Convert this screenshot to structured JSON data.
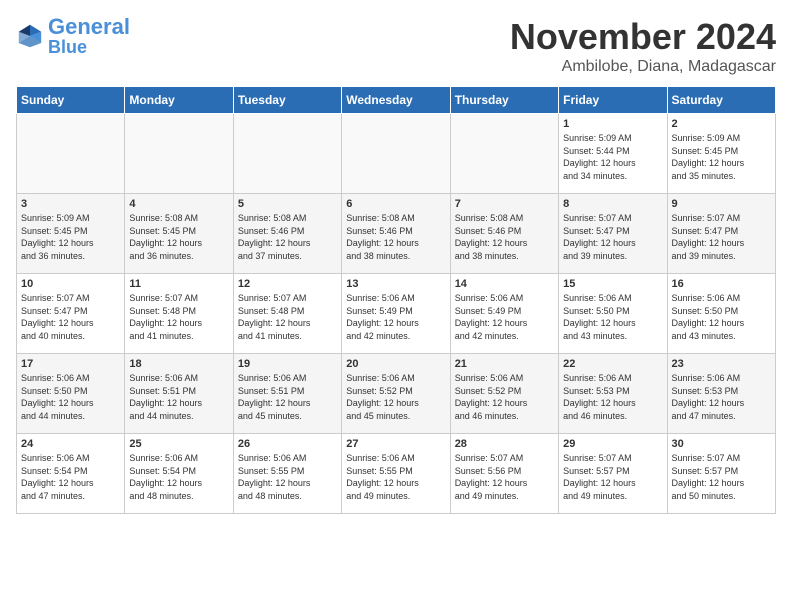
{
  "header": {
    "logo_line1": "General",
    "logo_line2": "Blue",
    "month_title": "November 2024",
    "subtitle": "Ambilobe, Diana, Madagascar"
  },
  "weekdays": [
    "Sunday",
    "Monday",
    "Tuesday",
    "Wednesday",
    "Thursday",
    "Friday",
    "Saturday"
  ],
  "weeks": [
    [
      {
        "day": "",
        "info": ""
      },
      {
        "day": "",
        "info": ""
      },
      {
        "day": "",
        "info": ""
      },
      {
        "day": "",
        "info": ""
      },
      {
        "day": "",
        "info": ""
      },
      {
        "day": "1",
        "info": "Sunrise: 5:09 AM\nSunset: 5:44 PM\nDaylight: 12 hours\nand 34 minutes."
      },
      {
        "day": "2",
        "info": "Sunrise: 5:09 AM\nSunset: 5:45 PM\nDaylight: 12 hours\nand 35 minutes."
      }
    ],
    [
      {
        "day": "3",
        "info": "Sunrise: 5:09 AM\nSunset: 5:45 PM\nDaylight: 12 hours\nand 36 minutes."
      },
      {
        "day": "4",
        "info": "Sunrise: 5:08 AM\nSunset: 5:45 PM\nDaylight: 12 hours\nand 36 minutes."
      },
      {
        "day": "5",
        "info": "Sunrise: 5:08 AM\nSunset: 5:46 PM\nDaylight: 12 hours\nand 37 minutes."
      },
      {
        "day": "6",
        "info": "Sunrise: 5:08 AM\nSunset: 5:46 PM\nDaylight: 12 hours\nand 38 minutes."
      },
      {
        "day": "7",
        "info": "Sunrise: 5:08 AM\nSunset: 5:46 PM\nDaylight: 12 hours\nand 38 minutes."
      },
      {
        "day": "8",
        "info": "Sunrise: 5:07 AM\nSunset: 5:47 PM\nDaylight: 12 hours\nand 39 minutes."
      },
      {
        "day": "9",
        "info": "Sunrise: 5:07 AM\nSunset: 5:47 PM\nDaylight: 12 hours\nand 39 minutes."
      }
    ],
    [
      {
        "day": "10",
        "info": "Sunrise: 5:07 AM\nSunset: 5:47 PM\nDaylight: 12 hours\nand 40 minutes."
      },
      {
        "day": "11",
        "info": "Sunrise: 5:07 AM\nSunset: 5:48 PM\nDaylight: 12 hours\nand 41 minutes."
      },
      {
        "day": "12",
        "info": "Sunrise: 5:07 AM\nSunset: 5:48 PM\nDaylight: 12 hours\nand 41 minutes."
      },
      {
        "day": "13",
        "info": "Sunrise: 5:06 AM\nSunset: 5:49 PM\nDaylight: 12 hours\nand 42 minutes."
      },
      {
        "day": "14",
        "info": "Sunrise: 5:06 AM\nSunset: 5:49 PM\nDaylight: 12 hours\nand 42 minutes."
      },
      {
        "day": "15",
        "info": "Sunrise: 5:06 AM\nSunset: 5:50 PM\nDaylight: 12 hours\nand 43 minutes."
      },
      {
        "day": "16",
        "info": "Sunrise: 5:06 AM\nSunset: 5:50 PM\nDaylight: 12 hours\nand 43 minutes."
      }
    ],
    [
      {
        "day": "17",
        "info": "Sunrise: 5:06 AM\nSunset: 5:50 PM\nDaylight: 12 hours\nand 44 minutes."
      },
      {
        "day": "18",
        "info": "Sunrise: 5:06 AM\nSunset: 5:51 PM\nDaylight: 12 hours\nand 44 minutes."
      },
      {
        "day": "19",
        "info": "Sunrise: 5:06 AM\nSunset: 5:51 PM\nDaylight: 12 hours\nand 45 minutes."
      },
      {
        "day": "20",
        "info": "Sunrise: 5:06 AM\nSunset: 5:52 PM\nDaylight: 12 hours\nand 45 minutes."
      },
      {
        "day": "21",
        "info": "Sunrise: 5:06 AM\nSunset: 5:52 PM\nDaylight: 12 hours\nand 46 minutes."
      },
      {
        "day": "22",
        "info": "Sunrise: 5:06 AM\nSunset: 5:53 PM\nDaylight: 12 hours\nand 46 minutes."
      },
      {
        "day": "23",
        "info": "Sunrise: 5:06 AM\nSunset: 5:53 PM\nDaylight: 12 hours\nand 47 minutes."
      }
    ],
    [
      {
        "day": "24",
        "info": "Sunrise: 5:06 AM\nSunset: 5:54 PM\nDaylight: 12 hours\nand 47 minutes."
      },
      {
        "day": "25",
        "info": "Sunrise: 5:06 AM\nSunset: 5:54 PM\nDaylight: 12 hours\nand 48 minutes."
      },
      {
        "day": "26",
        "info": "Sunrise: 5:06 AM\nSunset: 5:55 PM\nDaylight: 12 hours\nand 48 minutes."
      },
      {
        "day": "27",
        "info": "Sunrise: 5:06 AM\nSunset: 5:55 PM\nDaylight: 12 hours\nand 49 minutes."
      },
      {
        "day": "28",
        "info": "Sunrise: 5:07 AM\nSunset: 5:56 PM\nDaylight: 12 hours\nand 49 minutes."
      },
      {
        "day": "29",
        "info": "Sunrise: 5:07 AM\nSunset: 5:57 PM\nDaylight: 12 hours\nand 49 minutes."
      },
      {
        "day": "30",
        "info": "Sunrise: 5:07 AM\nSunset: 5:57 PM\nDaylight: 12 hours\nand 50 minutes."
      }
    ]
  ]
}
